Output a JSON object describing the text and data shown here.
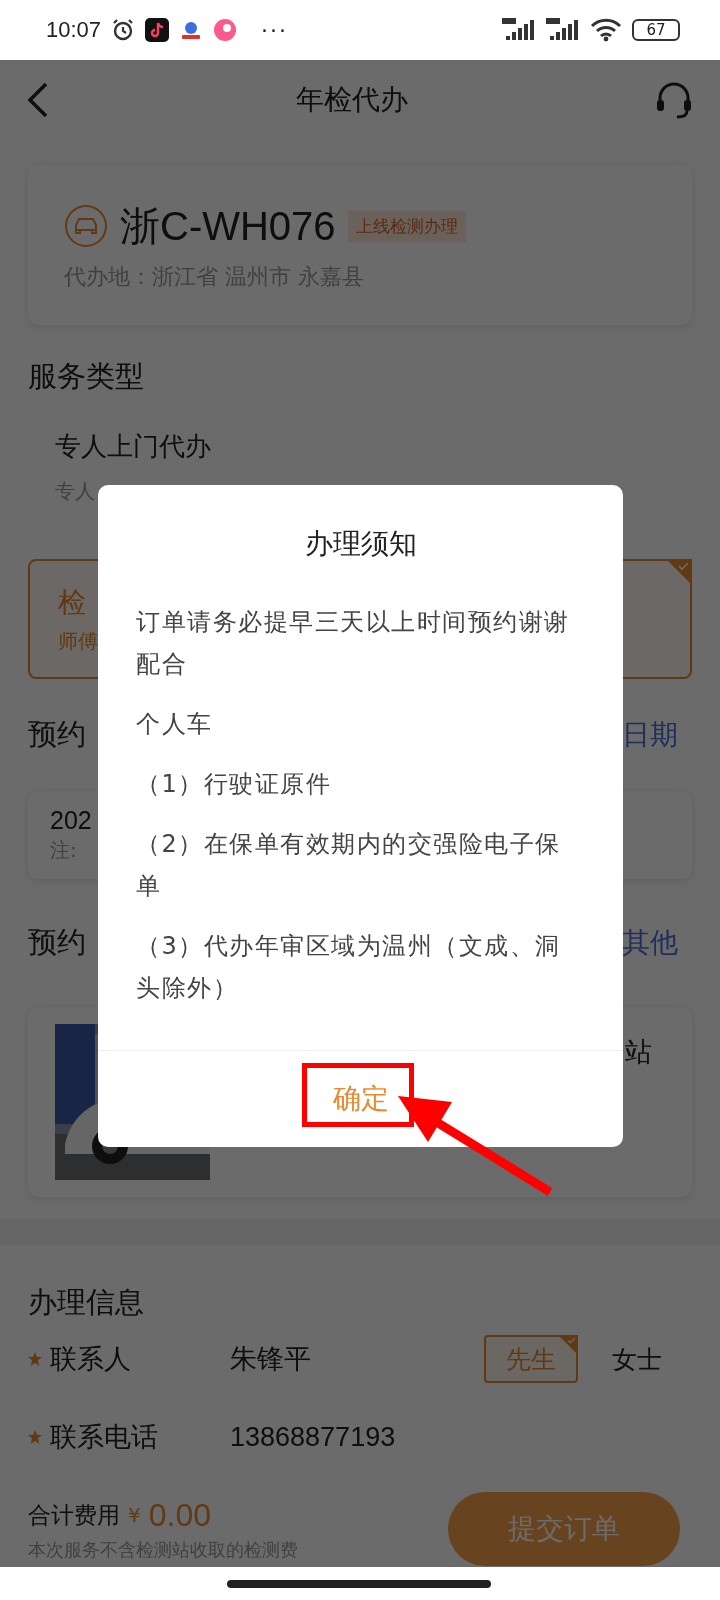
{
  "status_bar": {
    "time": "10:07",
    "more": "···",
    "battery": "67"
  },
  "header": {
    "title": "年检代办"
  },
  "vehicle": {
    "plate": "浙C-WH076",
    "tag": "上线检测办理",
    "location": "代办地：浙江省 温州市 永嘉县"
  },
  "service_type": {
    "heading": "服务类型",
    "option_title": "专人上门代办",
    "option_subtitle": "专人"
  },
  "selected_option": {
    "title": "检",
    "subtitle": "师傅",
    "selected": true
  },
  "appointment_date": {
    "heading": "预约",
    "action": "日期",
    "date": "202",
    "note": "注:"
  },
  "appointment_station": {
    "heading": "预约",
    "action": "其他",
    "station": "站"
  },
  "info": {
    "heading": "办理信息",
    "fields": [
      {
        "label": "联系人",
        "required": true,
        "value": "朱锋平"
      },
      {
        "label": "联系电话",
        "required": true,
        "value": "13868877193"
      }
    ],
    "titles": [
      {
        "label": "先生",
        "selected": true
      },
      {
        "label": "女士",
        "selected": false
      }
    ]
  },
  "footer": {
    "total_label": "合计费用",
    "currency": "¥",
    "amount": "0.00",
    "note": "本次服务不含检测站收取的检测费",
    "submit": "提交订单"
  },
  "dialog": {
    "title": "办理须知",
    "lines": [
      "订单请务必提早三天以上时间预约谢谢配合",
      "个人车",
      "（1）行驶证原件",
      "（2）在保单有效期内的交强险电子保单",
      "（3）代办年审区域为温州（文成、洞头除外）"
    ],
    "confirm": "确定"
  }
}
